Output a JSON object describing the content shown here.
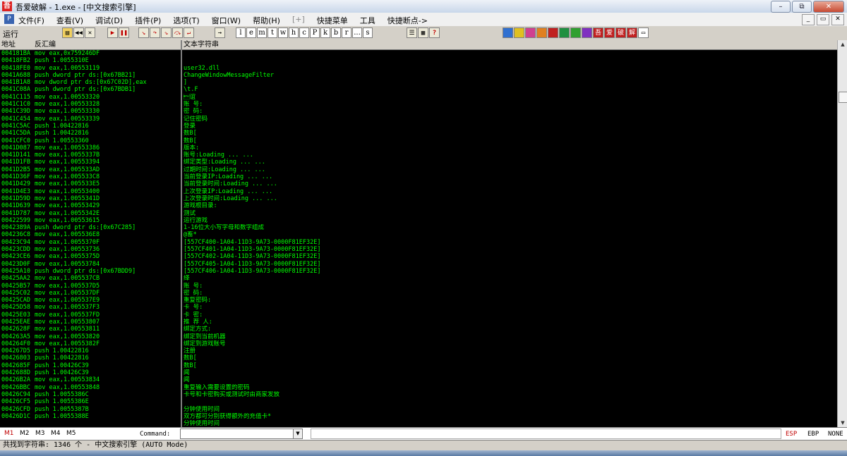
{
  "window": {
    "title": "吾爱破解 - 1.exe - [中文搜索引擎]",
    "buttons": [
      "–",
      "⧉",
      "✕"
    ]
  },
  "menu": {
    "items": [
      "文件(F)",
      "查看(V)",
      "调试(D)",
      "插件(P)",
      "选项(T)",
      "窗口(W)",
      "帮助(H)",
      "[+]",
      "快捷菜单",
      "工具",
      "快捷断点->"
    ],
    "mdi_buttons": [
      "_",
      "▭",
      "✕"
    ]
  },
  "toolbar": {
    "status": "运行",
    "letters": [
      "l",
      "e",
      "m",
      "t",
      "w",
      "h",
      "c",
      "P",
      "k",
      "b",
      "r",
      "...",
      "s"
    ],
    "colors": {
      "red": "#c00000",
      "accent_bg": "#ece9d8"
    }
  },
  "left_pane": {
    "headers": {
      "addr": "地址",
      "dis": "反汇编"
    },
    "rows": [
      [
        "004181BA",
        "mov eax,0x759246DF"
      ],
      [
        "00418FB2",
        "push 1.0055310E"
      ],
      [
        "00418FE0",
        "mov eax,1.00553119"
      ],
      [
        "0041A688",
        "push dword ptr ds:[0x67BB21]"
      ],
      [
        "0041B1A8",
        "mov dword ptr ds:[0x67C02D],eax"
      ],
      [
        "0041C08A",
        "push dword ptr ds:[0x67BDB1]"
      ],
      [
        "0041C115",
        "mov eax,1.00553320"
      ],
      [
        "0041C1C0",
        "mov eax,1.00553328"
      ],
      [
        "0041C39D",
        "mov eax,1.00553330"
      ],
      [
        "0041C454",
        "mov eax,1.00553339"
      ],
      [
        "0041C5AC",
        "push 1.00422816"
      ],
      [
        "0041C5DA",
        "push 1.00422816"
      ],
      [
        "0041CFC0",
        "push 1.00553360"
      ],
      [
        "0041D087",
        "mov eax,1.00553386"
      ],
      [
        "0041D141",
        "mov eax,1.0055337B"
      ],
      [
        "0041D1FB",
        "mov eax,1.00553394"
      ],
      [
        "0041D2B5",
        "mov eax,1.005533AD"
      ],
      [
        "0041D36F",
        "mov eax,1.005533C8"
      ],
      [
        "0041D429",
        "mov eax,1.005533E5"
      ],
      [
        "0041D4E3",
        "mov eax,1.00553400"
      ],
      [
        "0041D59D",
        "mov eax,1.0055341D"
      ],
      [
        "0041D639",
        "mov eax,1.00553429"
      ],
      [
        "0041D787",
        "mov eax,1.0055342E"
      ],
      [
        "00422599",
        "mov eax,1.00553615"
      ],
      [
        "0042389A",
        "push dword ptr ds:[0x67C285]"
      ],
      [
        "004236C8",
        "mov eax,1.005536E8"
      ],
      [
        "00423C94",
        "mov eax,1.0055370F"
      ],
      [
        "00423CDD",
        "mov eax,1.00553736"
      ],
      [
        "00423CE6",
        "mov eax,1.0055375D"
      ],
      [
        "00423D0F",
        "mov eax,1.00553784"
      ],
      [
        "00425A10",
        "push dword ptr ds:[0x67BDD9]"
      ],
      [
        "00425AA2",
        "mov eax,1.005537CB"
      ],
      [
        "00425B57",
        "mov eax,1.005537D5"
      ],
      [
        "00425C02",
        "mov eax,1.005537DF"
      ],
      [
        "00425CAD",
        "mov eax,1.005537E9"
      ],
      [
        "00425D58",
        "mov eax,1.005537F3"
      ],
      [
        "00425E03",
        "mov eax,1.005537FD"
      ],
      [
        "00425EAE",
        "mov eax,1.00553807"
      ],
      [
        "0042628F",
        "mov eax,1.00553811"
      ],
      [
        "004263A5",
        "mov eax,1.00553820"
      ],
      [
        "004264F0",
        "mov eax,1.0055382F"
      ],
      [
        "004267D5",
        "push 1.00422816"
      ],
      [
        "00426803",
        "push 1.00422816"
      ],
      [
        "0042685F",
        "push 1.00426C39"
      ],
      [
        "0042688D",
        "push 1.00426C39"
      ],
      [
        "00426B2A",
        "mov eax,1.00553834"
      ],
      [
        "00426BBC",
        "mov eax,1.00553848"
      ],
      [
        "00426C94",
        "push 1.0055386C"
      ],
      [
        "00426CF5",
        "push 1.0055386E"
      ],
      [
        "00426CFD",
        "push 1.0055387B"
      ],
      [
        "00426D1C",
        "push 1.0055388E"
      ]
    ]
  },
  "right_pane": {
    "header": "文本字符串",
    "rows": [
      "",
      "",
      "user32.dll",
      "ChangeWindowMessageFilter",
      "]",
      "\\t.F",
      "\u0003谊",
      "账    号:",
      "密    码:",
      "记住密码",
      "登录",
      "数B[",
      "数B[",
      "版本:",
      "账号:Loading ... ...",
      "绑定类型:Loading ... ...",
      "过期时间:Loading ... ...",
      "当前登录IP:Loading ... ...",
      "当前登录时间:Loading ... ...",
      "上次登录IP:Loading ... ...",
      "上次登录时间:Loading ... ...",
      "游戏根目录:",
      "测试",
      "运行游戏",
      "1-16位大小写字母和数字组成",
      "@畜*",
      "[557CF400-1A04-11D3-9A73-0000F81EF32E]",
      "[557CF401-1A04-11D3-9A73-0000F81EF32E]",
      "[557CF402-1A04-11D3-9A73-0000F81EF32E]",
      "[557CF405-1A04-11D3-9A73-0000F81EF32E]",
      "[557CF406-1A04-11D3-9A73-0000F81EF32E]",
      "绎",
      "账    号:",
      "密    码:",
      "重复密码:",
      "卡    号:",
      "卡    密:",
      "推 荐 人:",
      "绑定方式:",
      "绑定到当前机器",
      "绑定到游戏账号",
      "注册",
      "数B[",
      "数B[",
      "闻",
      "闻",
      "重复输入需要设置的密码",
      "卡号和卡密购买或测试时由商家发放",
      "",
      "分钟使用时间",
      "双方都可分别获得额外的充值卡*",
      "分钟使用时间"
    ]
  },
  "regbar": {
    "tabs": [
      "M1",
      "M2",
      "M3",
      "M4",
      "M5"
    ],
    "command_label": "Command:",
    "registers": [
      "ESP",
      "EBP",
      "NONE"
    ]
  },
  "statusbar": {
    "text": "共找到字符串: 1346 个  -  中文搜索引擎 (AUTO Mode)"
  }
}
